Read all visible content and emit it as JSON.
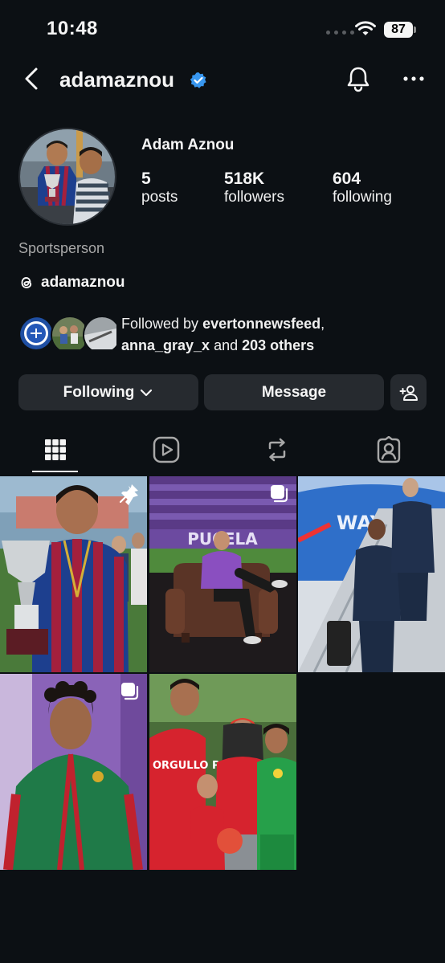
{
  "status_bar": {
    "time": "10:48",
    "battery": "87"
  },
  "header": {
    "username": "adamaznou",
    "icons": {
      "back": "chevron-left-icon",
      "verified": "verified-badge-icon",
      "notifications": "bell-icon",
      "more": "more-horizontal-icon"
    }
  },
  "profile": {
    "display_name": "Adam Aznou",
    "stats": [
      {
        "value": "5",
        "label": "posts"
      },
      {
        "value": "518K",
        "label": "followers"
      },
      {
        "value": "604",
        "label": "following"
      }
    ],
    "category": "Sportsperson",
    "threads_handle": "adamaznou"
  },
  "followed_by": {
    "prefix": "Followed by ",
    "user1": "evertonnewsfeed",
    "sep": ",",
    "user2": "anna_gray_x",
    "and": " and ",
    "others": "203 others"
  },
  "actions": {
    "following_label": "Following",
    "message_label": "Message"
  },
  "tabs": [
    {
      "name": "posts",
      "icon": "grid-icon",
      "active": true
    },
    {
      "name": "reels",
      "icon": "reels-icon",
      "active": false
    },
    {
      "name": "reposts",
      "icon": "repost-icon",
      "active": false
    },
    {
      "name": "tagged",
      "icon": "tagged-icon",
      "active": false
    }
  ],
  "posts": [
    {
      "badge": "pin-icon"
    },
    {
      "badge": "carousel-icon",
      "caption_sign": "PUCELA"
    },
    {
      "caption_sign": "WAYS"
    },
    {
      "badge": "carousel-icon"
    },
    {
      "caption_sign": "ORGULLO PASIÓN"
    }
  ]
}
